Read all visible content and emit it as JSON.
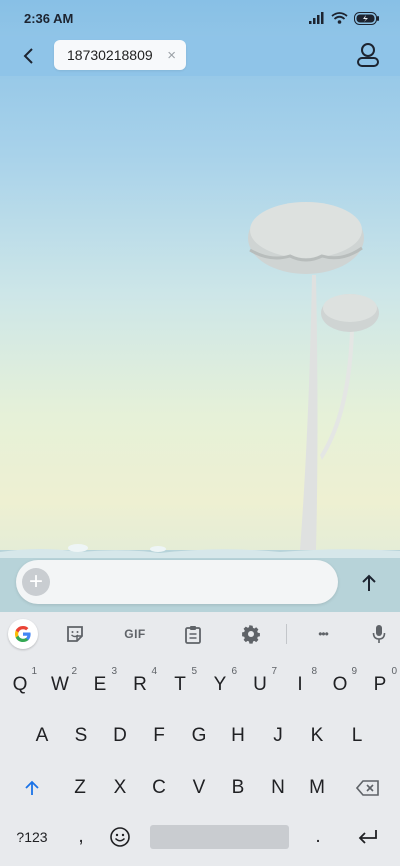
{
  "status_bar": {
    "time": "2:36 AM"
  },
  "header": {
    "recipient": "18730218809",
    "clear_glyph": "×"
  },
  "composer": {
    "plus_glyph": "+",
    "placeholder": ""
  },
  "keyboard": {
    "toolbar": {
      "gif_label": "GIF",
      "more_glyph": "•••"
    },
    "row1": [
      {
        "label": "Q",
        "hint": "1"
      },
      {
        "label": "W",
        "hint": "2"
      },
      {
        "label": "E",
        "hint": "3"
      },
      {
        "label": "R",
        "hint": "4"
      },
      {
        "label": "T",
        "hint": "5"
      },
      {
        "label": "Y",
        "hint": "6"
      },
      {
        "label": "U",
        "hint": "7"
      },
      {
        "label": "I",
        "hint": "8"
      },
      {
        "label": "O",
        "hint": "9"
      },
      {
        "label": "P",
        "hint": "0"
      }
    ],
    "row2": [
      "A",
      "S",
      "D",
      "F",
      "G",
      "H",
      "J",
      "K",
      "L"
    ],
    "row3": [
      "Z",
      "X",
      "C",
      "V",
      "B",
      "N",
      "M"
    ],
    "bottom": {
      "symbols_label": "?123",
      "comma": ",",
      "period": "."
    }
  },
  "colors": {
    "accent": "#1a73e8",
    "keyboard_bg": "#e8eaed",
    "topbar": "#8fc4e8"
  }
}
